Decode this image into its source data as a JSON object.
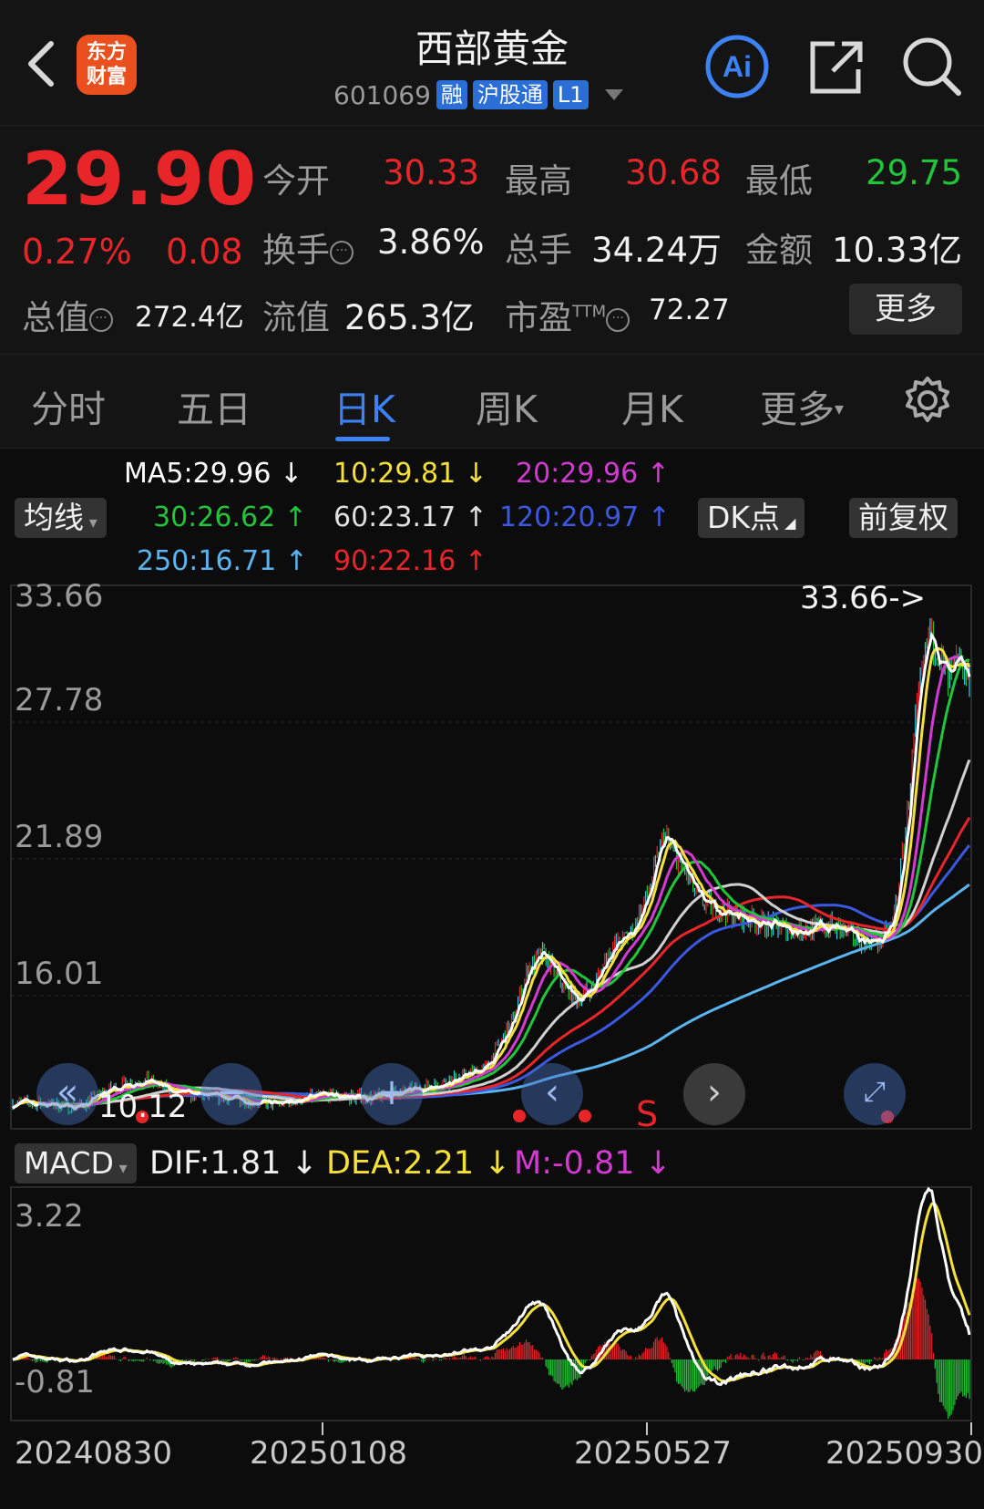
{
  "header": {
    "logo_line1": "东方",
    "logo_line2": "财富",
    "stock_name": "西部黄金",
    "stock_code": "601069",
    "tags": [
      "融",
      "沪股通",
      "L1"
    ]
  },
  "quote": {
    "price": "29.90",
    "change_pct": "0.27%",
    "change": "0.08",
    "open_label": "今开",
    "open": "30.33",
    "high_label": "最高",
    "high": "30.68",
    "low_label": "最低",
    "low": "29.75",
    "turnover_label": "换手",
    "turnover": "3.86%",
    "volume_label": "总手",
    "volume": "34.24万",
    "amount_label": "金额",
    "amount": "10.33亿",
    "mktcap_label": "总值",
    "mktcap": "272.4亿",
    "float_label": "流值",
    "float": "265.3亿",
    "pe_label": "市盈",
    "pe_sup": "TTM",
    "pe": "72.27",
    "more": "更多"
  },
  "tabs": [
    "分时",
    "五日",
    "日K",
    "周K",
    "月K",
    "更多"
  ],
  "active_tab": "日K",
  "ma": {
    "selector": "均线",
    "ma5": "MA5:29.96",
    "ma10": "10:29.81",
    "ma20": "20:29.96",
    "ma30": "30:26.62",
    "ma60": "60:23.17",
    "ma120": "120:20.97",
    "ma250": "250:16.71",
    "ma90": "90:22.16",
    "dk": "DK点",
    "adjust": "前复权"
  },
  "kline": {
    "y_labels": [
      "33.66",
      "27.78",
      "21.89",
      "16.01"
    ],
    "high_marker": "33.66->",
    "low_marker": "10.12",
    "signal": "S"
  },
  "macd": {
    "selector": "MACD",
    "dif": "DIF:1.81",
    "dea": "DEA:2.21",
    "m": "M:-0.81",
    "y_top": "3.22",
    "y_bottom": "-0.81"
  },
  "dates": [
    "20240830",
    "20250108",
    "20250527",
    "20250930"
  ],
  "colors": {
    "up": "#e8262a",
    "down": "#22c43a",
    "accent": "#3d82f5",
    "ma5": "#ffffff",
    "ma10": "#f5e03a",
    "ma20": "#d23ad2",
    "ma30": "#22c43a",
    "ma60": "#d0d0d0",
    "ma120": "#3a58e0",
    "ma250": "#5ab4f0",
    "ma90": "#e8262a"
  }
}
